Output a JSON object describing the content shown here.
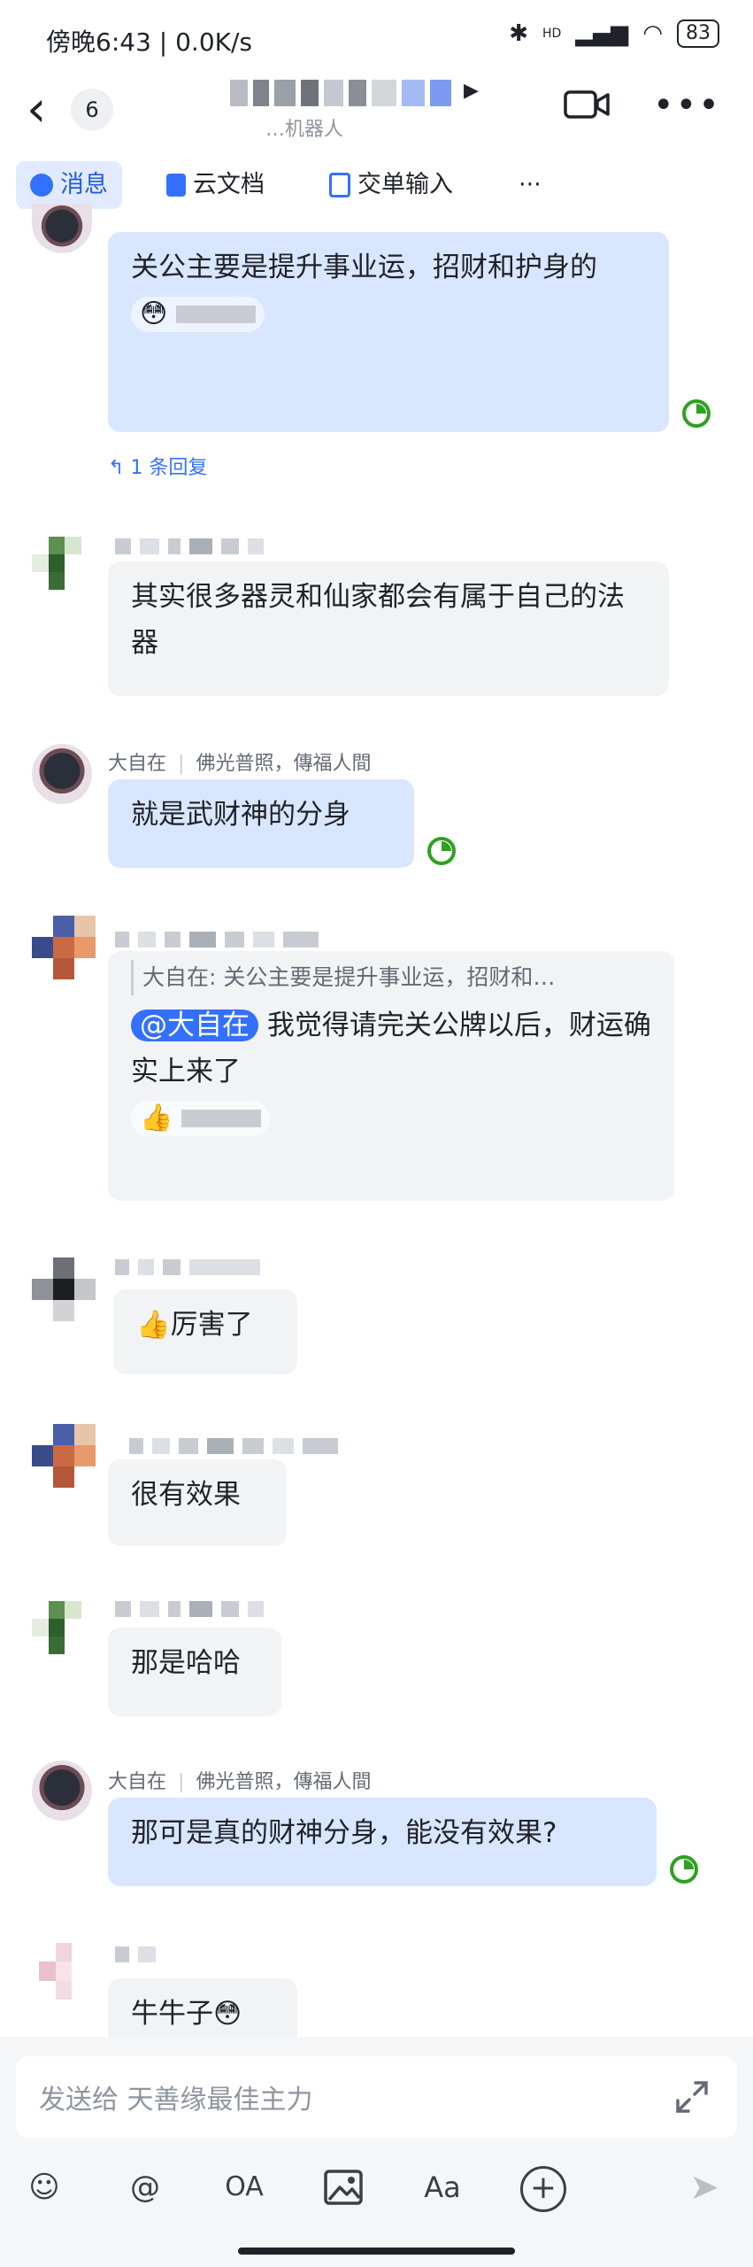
{
  "status_bar": {
    "time_speed": "傍晚6:43 | 0.0K/s",
    "network": "HD",
    "battery": "83"
  },
  "header": {
    "unread_count": "6",
    "subtitle": "…机器人"
  },
  "tabs": [
    {
      "label": "消息",
      "active": true
    },
    {
      "label": "云文档",
      "active": false
    },
    {
      "label": "交单输入",
      "active": false
    },
    {
      "label": "···",
      "active": false
    }
  ],
  "messages": [
    {
      "text": "关公主要是提升事业运，招财和护身的",
      "reaction": "😳",
      "reply_count": "1 条回复"
    },
    {
      "text": "其实很多器灵和仙家都会有属于自己的法器"
    },
    {
      "sender": "大自在",
      "sender_note": "佛光普照，傳福人間",
      "text": "就是武财神的分身"
    },
    {
      "quote": "大自在: 关公主要是提升事业运，招财和…",
      "mention": "@大自在",
      "text": "我觉得请完关公牌以后，财运确实上来了",
      "reaction": "👍"
    },
    {
      "text": "👍厉害了"
    },
    {
      "text": "很有效果"
    },
    {
      "text": "那是哈哈"
    },
    {
      "sender": "大自在",
      "sender_note": "佛光普照，傳福人間",
      "text": "那可是真的财神分身，能没有效果?"
    },
    {
      "text": "牛牛子😳"
    }
  ],
  "input": {
    "placeholder": "发送给 天善缘最佳主力"
  },
  "toolbar": {
    "emoji": "☺",
    "mention": "@",
    "okr": "OA",
    "image": "image",
    "font": "Aa",
    "add": "+",
    "send": "➤"
  },
  "colors": {
    "accent": "#3370ff",
    "my_bubble": "#d9e6ff",
    "other_bubble": "#f2f3f5",
    "read_check": "#2ea121"
  }
}
